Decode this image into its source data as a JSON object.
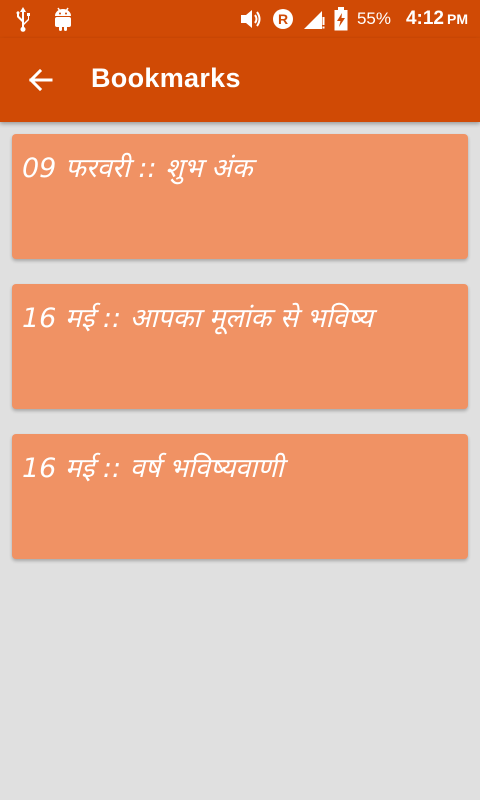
{
  "status_bar": {
    "battery_percent": "55%",
    "time": "4:12",
    "ampm": "PM",
    "icons": [
      "usb-icon",
      "android-icon",
      "volume-icon",
      "roaming-icon",
      "signal-icon",
      "battery-charging-icon"
    ]
  },
  "app_bar": {
    "title": "Bookmarks",
    "back_icon": "arrow-back-icon",
    "color": "#d04a05"
  },
  "bookmarks": [
    {
      "label": "09 फरवरी :: शुभ अंक"
    },
    {
      "label": "16 मई :: आपका मूलांक से भविष्य"
    },
    {
      "label": "16 मई :: वर्ष भविष्यवाणी"
    }
  ],
  "colors": {
    "card": "#f09264",
    "background": "#e0e0e0"
  }
}
